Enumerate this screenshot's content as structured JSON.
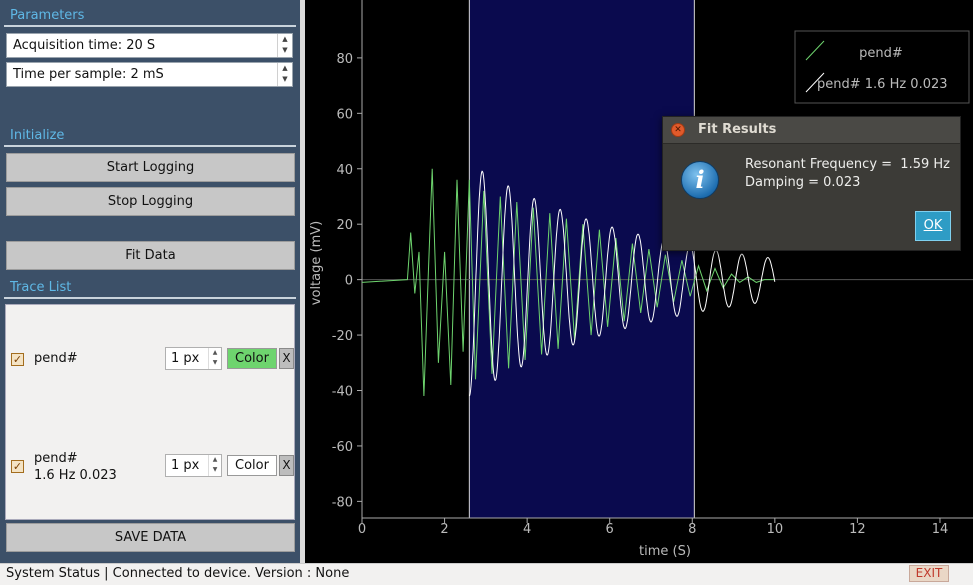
{
  "parameters": {
    "header": "Parameters",
    "acquisition_time": "Acquisition time: 20 S",
    "time_per_sample": "Time per sample: 2 mS"
  },
  "initialize": {
    "header": "Initialize",
    "start_label": "Start Logging",
    "stop_label": "Stop Logging",
    "fit_label": "Fit Data"
  },
  "trace_list": {
    "header": "Trace List",
    "items": [
      {
        "name": "pend#",
        "width": "1 px",
        "color_label": "Color",
        "remove_label": "X",
        "checked": true,
        "color": "#6ed46e"
      },
      {
        "name": "pend#",
        "detail": "1.6  Hz 0.023",
        "width": "1 px",
        "color_label": "Color",
        "remove_label": "X",
        "checked": true,
        "color": "#ffffff"
      }
    ]
  },
  "save_label": "SAVE DATA",
  "status": {
    "text": "System Status | Connected to device. Version : None",
    "exit_label": "EXIT"
  },
  "dialog": {
    "title": "Fit Results",
    "line1": "Resonant Frequency =  1.59 Hz",
    "line2": "Damping = 0.023",
    "ok_label": "OK"
  },
  "chart_data": {
    "type": "line",
    "title": "",
    "xlabel": "time (S)",
    "ylabel": "voltage (mV)",
    "xlim": [
      0,
      14.8
    ],
    "ylim": [
      -86,
      98
    ],
    "xticks": [
      0,
      2,
      4,
      6,
      8,
      10,
      12,
      14
    ],
    "yticks": [
      -80,
      -60,
      -40,
      -20,
      0,
      20,
      40,
      60,
      80
    ],
    "grid": false,
    "legend_position": "top-right",
    "selected_region": [
      2.6,
      8.05
    ],
    "series": [
      {
        "name": "pend#",
        "color": "#6ed46e",
        "x": [
          0.0,
          1.1,
          1.18,
          1.28,
          1.38,
          1.5,
          1.6,
          1.7,
          1.85,
          2.0,
          2.15,
          2.3,
          2.45,
          2.6,
          2.75,
          2.95,
          3.15,
          3.35,
          3.55,
          3.75,
          3.95,
          4.15,
          4.35,
          4.55,
          4.75,
          4.95,
          5.15,
          5.35,
          5.55,
          5.75,
          5.95,
          6.15,
          6.35,
          6.55,
          6.75,
          6.95,
          7.15,
          7.35,
          7.55,
          7.75,
          7.95,
          8.15,
          8.35,
          8.55,
          8.75,
          8.95,
          9.15,
          9.35,
          9.55,
          9.75,
          10.0
        ],
        "y": [
          -1,
          0,
          17,
          -5,
          10,
          -42,
          0,
          40,
          -30,
          10,
          -38,
          36,
          -26,
          36,
          -36,
          32,
          -34,
          30,
          -32,
          28,
          -29,
          26,
          -27,
          24,
          -25,
          22,
          -22,
          20,
          -20,
          18,
          -17,
          15,
          -15,
          13,
          -12,
          11,
          -10,
          9,
          -8,
          7,
          -6,
          5,
          -4,
          4,
          -3,
          2,
          -1,
          1,
          -1,
          0,
          0
        ]
      },
      {
        "name": "pend# 1.6 Hz 0.023",
        "color": "#ffffff",
        "amplitude": 42,
        "frequency_hz": 1.59,
        "damping": 0.023,
        "x_range": [
          2.6,
          10.0
        ]
      }
    ]
  }
}
